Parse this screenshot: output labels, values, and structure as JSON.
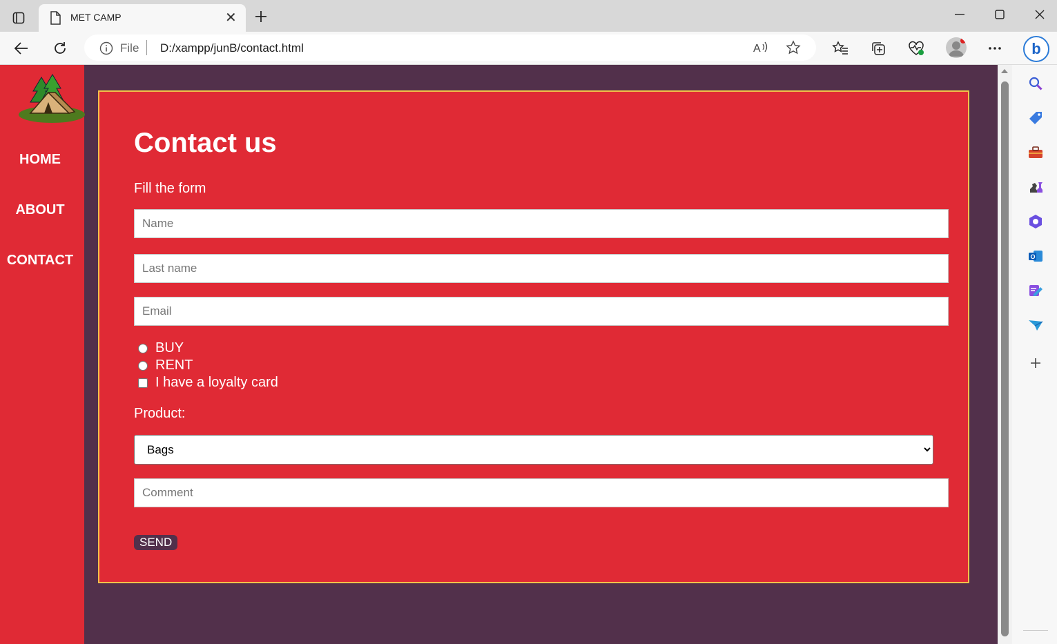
{
  "browser": {
    "tab_title": "MET CAMP",
    "address_scheme": "File",
    "url": "D:/xampp/junB/contact.html"
  },
  "nav": {
    "items": [
      {
        "label": "HOME"
      },
      {
        "label": "ABOUT"
      },
      {
        "label": "CONTACT"
      }
    ]
  },
  "form": {
    "title": "Contact us",
    "subtitle": "Fill the form",
    "name_placeholder": "Name",
    "lastname_placeholder": "Last name",
    "email_placeholder": "Email",
    "options": {
      "buy_label": "BUY",
      "rent_label": "RENT",
      "loyalty_label": "I have a loyalty card"
    },
    "product_label": "Product:",
    "product_selected": "Bags",
    "comment_placeholder": "Comment",
    "send_label": "SEND"
  },
  "colors": {
    "nav_bg": "#e02a35",
    "page_bg": "#52304b",
    "card_border": "#f2c14a",
    "button_bg": "#52304b"
  }
}
